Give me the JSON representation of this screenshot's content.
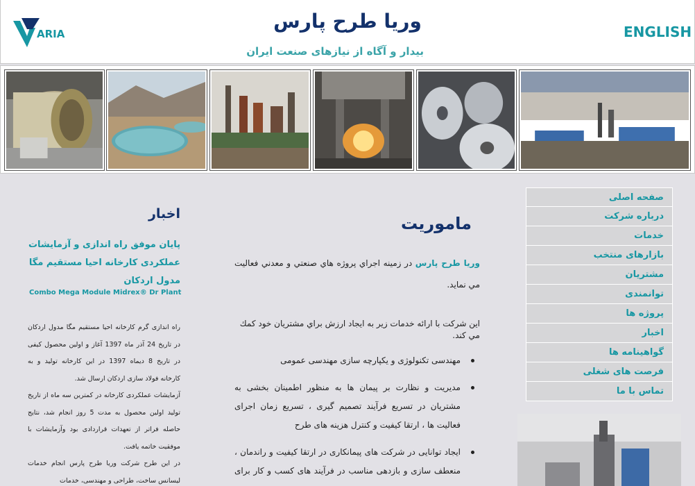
{
  "header": {
    "logo_text": "VARIA",
    "english_link": "ENGLISH",
    "title": "وریا طرح پارس",
    "tagline": "بیدار و آگاه از نیازهای صنعت ایران"
  },
  "nav": {
    "items": [
      "صفحه اصلی",
      "درباره شرکت",
      "خدمات",
      "بازارهای منتخب",
      "مشتریان",
      "توانمندی",
      "پروژه ها",
      "اخبار",
      "گواهینامه ها",
      "فرصت های شغلی",
      "تماس با ما"
    ]
  },
  "mission": {
    "title": "ماموریت",
    "brand": "وريا طرح پارس",
    "intro": " در زمينه اجراي پروژه هاي صنعتي و معدني فعاليت مي نمايد.",
    "p2": "اين شركت با ارائه خدمات زير به ايجاد ارزش براي مشتريان خود كمك مي كند.",
    "bullets": [
      "مهندسی تکنولوژی و یکپارچه سازی مهندسی عمومی",
      "مدیریت و نظارت بر پیمان ها به منظور اطمینان بخشی به مشتریان در تسریع فرآیند تصمیم گیری ، تسریع زمان اجرای فعالیت ها ، ارتقا کیفیت و کنترل هزینه های طرح",
      "ایجاد توانایی در شرکت های پیمانکاری در ارتقا کیفیت و راندمان ، منعطف سازی و بازدهی مناسب در فرآیند های کسب و کار برای اجرای پروژه ها به صورت GC , EP , EPC"
    ]
  },
  "news": {
    "title": "اخبار",
    "headline": "پایان موفق راه اندازی و آزمایشات عملکردی کارخانه احیا مستقیم مگا مدول اردکان",
    "latin": "Combo Mega Module Midrex® Dr Plant",
    "body_1": "راه اندازی گرم کارخانه احیا مستقیم مگا مدول اردکان در تاریخ 24 آذر ماه 1397 آغاز و اولین محصول کیفی در تاریخ 8 دیماه 1397 در این کارخانه تولید و به کارخانه فولاد سازی اردکان ارسال شد.",
    "body_2": "آزمایشات عملکردی کارخانه در کمترین سه ماه از تاریخ تولید اولین محصول به مدت 5 روز انجام شد، نتایج حاصله فراتر از تعهدات قراردادی بود وآزمایشات با موفقیت خاتمه یافت.",
    "body_3": "در این طرح شرکت وریا طرح پارس انجام خدمات لیسانس ساخت، طراحی و مهندسی، خدمات"
  },
  "colors": {
    "accent": "#1797a3",
    "navy": "#13316b",
    "background": "#e2e1e6"
  }
}
